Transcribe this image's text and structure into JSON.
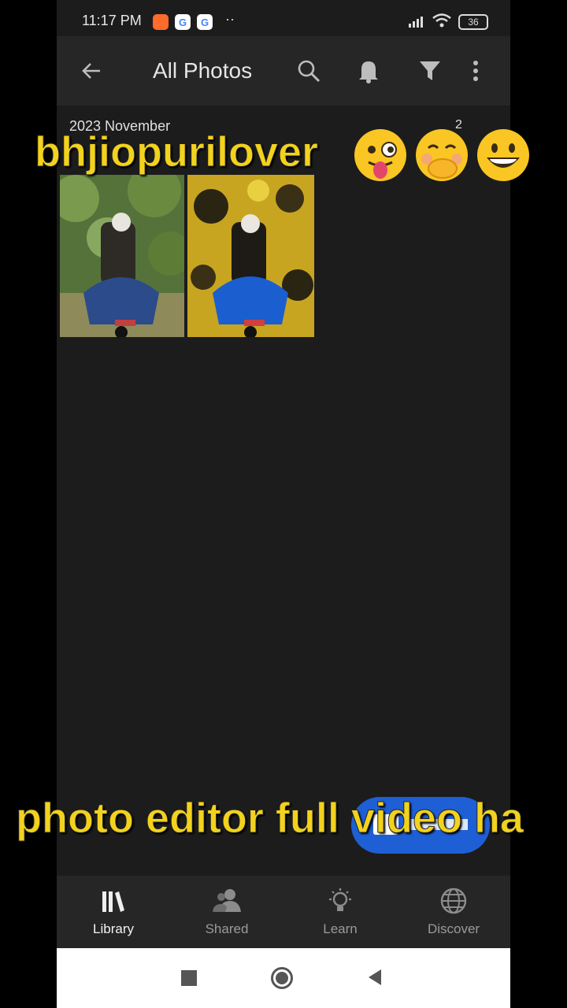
{
  "status_bar": {
    "time": "11:17 PM",
    "notification_icons": [
      "video-icon",
      "google-icon",
      "google-icon",
      "more-dots-icon"
    ],
    "battery": "36"
  },
  "app_bar": {
    "title": "All Photos",
    "icons": [
      "back-arrow-icon",
      "search-icon",
      "bell-icon",
      "filter-icon",
      "more-vert-icon"
    ]
  },
  "section": {
    "date": "2023 November",
    "count": "2"
  },
  "photos": [
    {
      "name": "photo-thumbnail",
      "palette": "green-natural"
    },
    {
      "name": "photo-thumbnail",
      "palette": "yellow-edited"
    }
  ],
  "bottom_nav": {
    "items": [
      {
        "label": "Library",
        "icon": "library-icon",
        "active": true
      },
      {
        "label": "Shared",
        "icon": "people-icon",
        "active": false
      },
      {
        "label": "Learn",
        "icon": "lightbulb-icon",
        "active": false
      },
      {
        "label": "Discover",
        "icon": "globe-icon",
        "active": false
      }
    ]
  },
  "overlays": {
    "top_text": "bhjiopurilover",
    "bottom_text": "photo editor full video ha"
  },
  "colors": {
    "overlay_text": "#f2d21d",
    "fab": "#1f5fd6",
    "app_bg": "#1c1c1c",
    "bar_bg": "#262626"
  }
}
